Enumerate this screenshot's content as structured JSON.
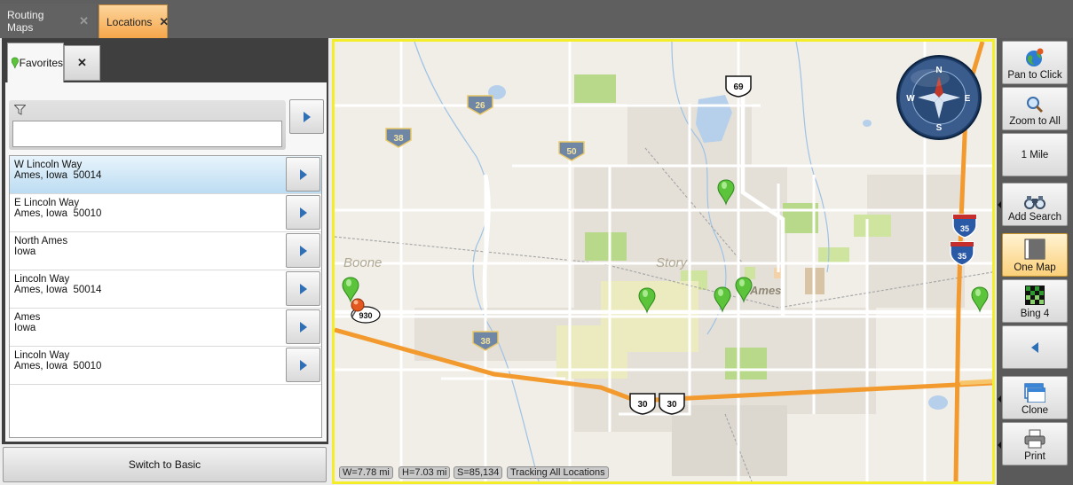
{
  "tabs": {
    "routing": "Routing Maps",
    "locations": "Locations",
    "close_glyph": "✕"
  },
  "panel": {
    "favorites_tab": "Favorites",
    "close_glyph": "✕",
    "search_placeholder": "",
    "search_value": "",
    "switch_basic": "Switch to Basic",
    "items": [
      {
        "line1": "W Lincoln Way",
        "line2": "Ames, Iowa  50014",
        "selected": true
      },
      {
        "line1": "E Lincoln Way",
        "line2": "Ames, Iowa  50010",
        "selected": false
      },
      {
        "line1": "North Ames",
        "line2": "Iowa",
        "selected": false
      },
      {
        "line1": "Lincoln Way",
        "line2": "Ames, Iowa  50014",
        "selected": false
      },
      {
        "line1": "Ames",
        "line2": "Iowa",
        "selected": false
      },
      {
        "line1": "Lincoln Way",
        "line2": "Ames, Iowa  50010",
        "selected": false
      }
    ]
  },
  "map": {
    "places": {
      "boone": "Boone",
      "story": "Story",
      "ames": "Ames"
    },
    "shields": {
      "hwy26": "26",
      "hwy38_top": "38",
      "hwy50": "50",
      "hwy38_bottom": "38",
      "us69": "69",
      "us30_a": "30",
      "us30_b": "30",
      "i35_a": "35",
      "i35_b": "35",
      "cr930": "930"
    },
    "compass": {
      "n": "N",
      "e": "E",
      "s": "S",
      "w": "W"
    },
    "status": {
      "width": "W=7.78 mi",
      "height": "H=7.03 mi",
      "scale": "S=85,134",
      "tracking": "Tracking All Locations"
    },
    "colors": {
      "frame": "#f4ee2a",
      "highway": "#f29a2e",
      "pin": "#5cc43a"
    }
  },
  "toolbar": {
    "pan_to_click": "Pan to Click",
    "zoom_to_all": "Zoom to All",
    "scale": "1 Mile",
    "add_search": "Add Search",
    "one_map": "One Map",
    "bing4": "Bing 4",
    "clone": "Clone",
    "print": "Print"
  }
}
